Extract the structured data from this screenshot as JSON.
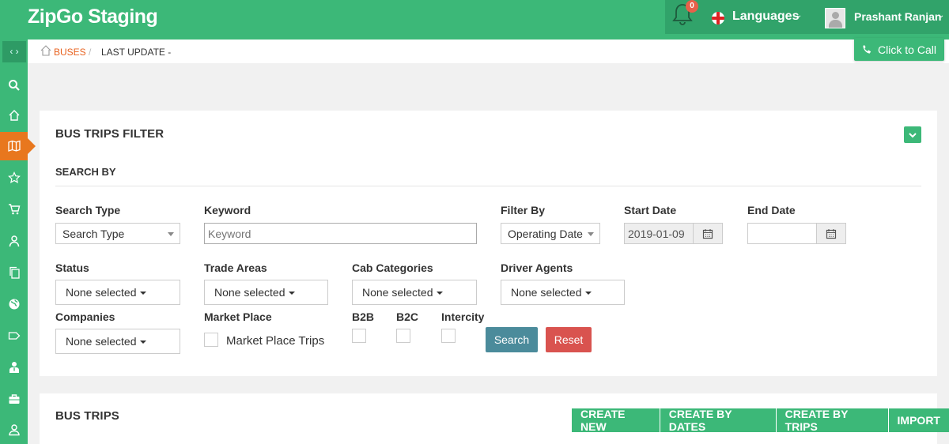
{
  "app": {
    "title": "ZipGo Staging"
  },
  "header": {
    "notification_count": "0",
    "languages_label": "Languages",
    "user_name": "Prashant Ranjan"
  },
  "sidebar": {
    "items": [
      {
        "icon": "search-icon"
      },
      {
        "icon": "home-icon"
      },
      {
        "icon": "map-icon",
        "active": true
      },
      {
        "icon": "star-icon"
      },
      {
        "icon": "cart-icon"
      },
      {
        "icon": "user-icon"
      },
      {
        "icon": "copy-icon"
      },
      {
        "icon": "globe-icon"
      },
      {
        "icon": "tag-icon"
      },
      {
        "icon": "driver-icon"
      },
      {
        "icon": "briefcase-icon"
      },
      {
        "icon": "profile-icon"
      }
    ]
  },
  "breadcrumb": {
    "item1": "BUSES",
    "separator": "/",
    "item2": "LAST UPDATE -"
  },
  "call_button": "Click to Call",
  "filter": {
    "title": "BUS TRIPS FILTER",
    "section_title": "SEARCH BY",
    "search_type": {
      "label": "Search Type",
      "value": "Search Type"
    },
    "keyword": {
      "label": "Keyword",
      "placeholder": "Keyword"
    },
    "filter_by": {
      "label": "Filter By",
      "value": "Operating Date"
    },
    "start_date": {
      "label": "Start Date",
      "value": "2019-01-09"
    },
    "end_date": {
      "label": "End Date",
      "value": ""
    },
    "status": {
      "label": "Status",
      "value": "None selected"
    },
    "trade_areas": {
      "label": "Trade Areas",
      "value": "None selected"
    },
    "cab_categories": {
      "label": "Cab Categories",
      "value": "None selected"
    },
    "driver_agents": {
      "label": "Driver Agents",
      "value": "None selected"
    },
    "companies": {
      "label": "Companies",
      "value": "None selected"
    },
    "market_place": {
      "label": "Market Place",
      "option": "Market Place Trips"
    },
    "b2b": {
      "label": "B2B"
    },
    "b2c": {
      "label": "B2C"
    },
    "intercity": {
      "label": "Intercity"
    },
    "search_button": "Search",
    "reset_button": "Reset"
  },
  "trips": {
    "title": "BUS TRIPS",
    "actions": [
      "CREATE NEW",
      "CREATE BY DATES",
      "CREATE BY TRIPS",
      "IMPORT"
    ]
  },
  "colors": {
    "primary": "#3cb878",
    "accent": "#e8771e",
    "danger": "#d9534f",
    "info": "#4b8b9b"
  }
}
